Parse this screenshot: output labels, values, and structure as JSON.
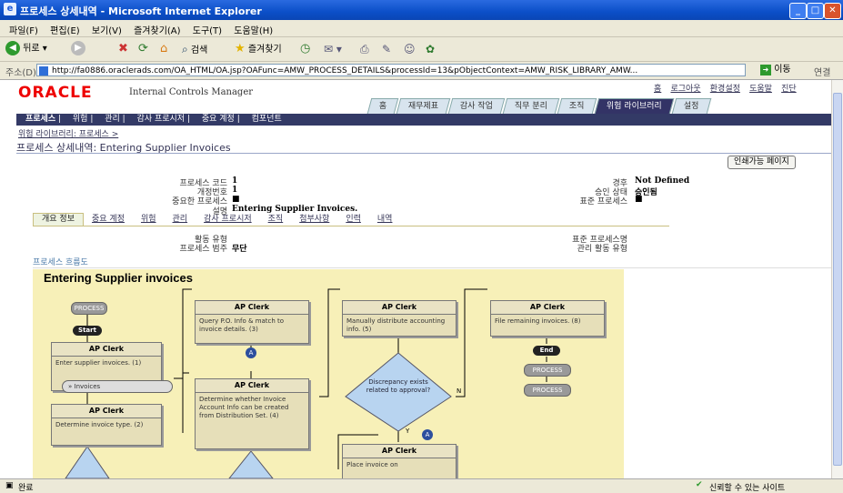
{
  "window": {
    "title": "프로세스 상세내역 - Microsoft Internet Explorer"
  },
  "menu": [
    "파일(F)",
    "편집(E)",
    "보기(V)",
    "즐겨찾기(A)",
    "도구(T)",
    "도움말(H)"
  ],
  "toolbar": {
    "back": "뒤로",
    "search": "검색",
    "favorites": "즐겨찾기"
  },
  "address": {
    "label": "주소(D)",
    "url": "http://fa0886.oraclerads.com/OA_HTML/OA.jsp?OAFunc=AMW_PROCESS_DETAILS&processId=13&pObjectContext=AMW_RISK_LIBRARY_AMW...",
    "go": "이동",
    "links": "연결"
  },
  "app": {
    "logo": "ORACLE",
    "product": "Internal Controls Manager",
    "toplinks": [
      "홈",
      "로그아웃",
      "환경설정",
      "도움말",
      "진단"
    ],
    "tabs": [
      "홈",
      "재무제표",
      "감사 작업",
      "직무 분리",
      "조직",
      "위험 라이브러리",
      "설정"
    ],
    "active_tab": "위험 라이브러리",
    "subnav": [
      "프로세스",
      "위험",
      "관리",
      "감사 프로시저",
      "중요 계정",
      "컴포넌트"
    ],
    "breadcrumb": "위험 라이브러리: 프로세스 >",
    "page_title": "프로세스 상세내역: Entering Supplier Invoices",
    "print_button": "인쇄가능 페이지",
    "fields_left": [
      {
        "label": "프로세스 코드",
        "value": "1"
      },
      {
        "label": "개정번호",
        "value": "1"
      },
      {
        "label": "중요한 프로세스",
        "value": "■"
      },
      {
        "label": "설명",
        "value": "Entering Supplier Invoices."
      }
    ],
    "fields_right": [
      {
        "label": "경후",
        "value": "Not Defined"
      },
      {
        "label": "승인 상태",
        "value": "승인됨"
      },
      {
        "label": "표준 프로세스",
        "value": "■"
      }
    ],
    "subtabs": [
      "개요 정보",
      "중요 계정",
      "위험",
      "관리",
      "감사 프로시저",
      "조직",
      "첨부사항",
      "인력",
      "내역"
    ],
    "active_subtab": "개요 정보",
    "fields2_left": [
      {
        "label": "활동 유형",
        "value": ""
      },
      {
        "label": "프로세스 범주",
        "value": "무단"
      }
    ],
    "fields2_right": [
      {
        "label": "표준 프로세스명",
        "value": ""
      },
      {
        "label": "관리 활동 유형",
        "value": ""
      }
    ],
    "flow_section_label": "프로세스 흐름도",
    "diagram": {
      "title": "Entering Supplier invoices",
      "process_label": "PROCESS",
      "start": "Start",
      "end": "End",
      "boxes": [
        {
          "role": "AP Clerk",
          "text": "Enter supplier invoices. (1)"
        },
        {
          "role": "AP Clerk",
          "text": "Determine invoice type. (2)"
        },
        {
          "role": "AP Clerk",
          "text": "Query P.O. Info & match to invoice details. (3)"
        },
        {
          "role": "AP Clerk",
          "text": "Determine whether Invoice Account Info can be created from Distribution Set. (4)"
        },
        {
          "role": "AP Clerk",
          "text": "Manually distribute accounting info. (5)"
        },
        {
          "role": "AP Clerk",
          "text": "Place invoice on"
        },
        {
          "role": "AP Clerk",
          "text": "File remaining invoices. (8)"
        }
      ],
      "invoices_doc": "Invoices",
      "decision": "Discrepancy exists related to approval?",
      "yes": "Y",
      "no": "N",
      "marker": "A"
    }
  },
  "status": {
    "left": "완료",
    "right": "신뢰할 수 있는 사이트"
  }
}
